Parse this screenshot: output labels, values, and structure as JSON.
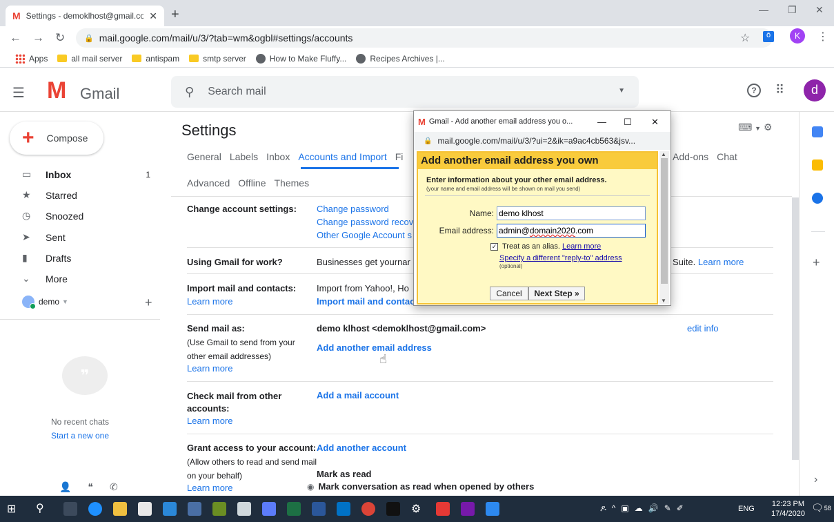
{
  "browser": {
    "tab_title": "Settings - demoklhost@gmail.co",
    "url": "mail.google.com/mail/u/3/?tab=wm&ogbl#settings/accounts",
    "profile_initial": "K",
    "bookmarks": [
      "Apps",
      "all mail server",
      "antispam",
      "smtp server",
      "How to Make Fluffy...",
      "Recipes Archives |..."
    ]
  },
  "gmail": {
    "app_name": "Gmail",
    "search_placeholder": "Search mail",
    "avatar_initial": "d",
    "compose_label": "Compose",
    "nav": [
      {
        "label": "Inbox",
        "count": "1"
      },
      {
        "label": "Starred",
        "count": ""
      },
      {
        "label": "Snoozed",
        "count": ""
      },
      {
        "label": "Sent",
        "count": ""
      },
      {
        "label": "Drafts",
        "count": ""
      },
      {
        "label": "More",
        "count": ""
      }
    ],
    "account_name": "demo",
    "no_recent_chats": "No recent chats",
    "start_new": "Start a new one"
  },
  "settings": {
    "title": "Settings",
    "tabs_row1": [
      "General",
      "Labels",
      "Inbox",
      "Accounts and Import",
      "Fi"
    ],
    "tabs_row1_right": [
      "Add-ons",
      "Chat"
    ],
    "tabs_row2": [
      "Advanced",
      "Offline",
      "Themes"
    ],
    "change_account": {
      "label": "Change account settings:",
      "links": [
        "Change password",
        "Change password recov",
        "Other Google Account s"
      ]
    },
    "work": {
      "label": "Using Gmail for work?",
      "text": "Businesses get yournar",
      "suffix": "Suite.",
      "learn_more": "Learn more"
    },
    "import": {
      "label": "Import mail and contacts:",
      "learn_more": "Learn more",
      "text": "Import from Yahoo!, Ho",
      "link": "Import mail and contac"
    },
    "send_as": {
      "label": "Send mail as:",
      "sub": "(Use Gmail to send from your other email addresses)",
      "learn_more": "Learn more",
      "identity": "demo klhost <demoklhost@gmail.com>",
      "add_link": "Add another email address",
      "edit": "edit info"
    },
    "check_mail": {
      "label": "Check mail from other accounts:",
      "learn_more": "Learn more",
      "link": "Add a mail account"
    },
    "grant": {
      "label": "Grant access to your account:",
      "sub": "(Allow others to read and send mail on your behalf)",
      "learn_more": "Learn more",
      "link": "Add another account",
      "mark_read": "Mark as read",
      "option": "Mark conversation as read when opened by others"
    }
  },
  "popup": {
    "window_title": "Gmail - Add another email address you o...",
    "url": "mail.google.com/mail/u/3/?ui=2&ik=a9ac4cb563&jsv...",
    "heading": "Add another email address you own",
    "info": "Enter information about your other email address.",
    "note": "(your name and email address will be shown on mail you send)",
    "name_label": "Name:",
    "name_value": "demo klhost",
    "email_label": "Email address:",
    "email_value_prefix": "admin@",
    "email_value_err": "domain2020",
    "email_value_suffix": ".com",
    "alias_label": "Treat as an alias.",
    "alias_learn": "Learn more",
    "reply_to": "Specify a different \"reply-to\" address",
    "optional": "(optional)",
    "cancel": "Cancel",
    "next": "Next Step »",
    "alias_checked": true
  },
  "taskbar": {
    "lang": "ENG",
    "time": "12:23 PM",
    "date": "17/4/2020",
    "notifications": "58"
  },
  "colors": {
    "gmail_red": "#ea4335",
    "link_blue": "#1a73e8",
    "popup_header": "#f9cb3c",
    "popup_body": "#fff9c4"
  }
}
